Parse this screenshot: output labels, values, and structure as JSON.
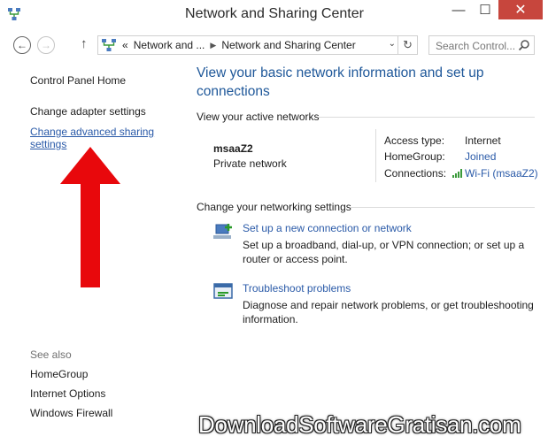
{
  "window": {
    "title": "Network and Sharing Center",
    "controls": {
      "minimize": "—",
      "maximize": "☐",
      "close": "✕"
    }
  },
  "navigation": {
    "back_icon": "←",
    "forward_icon": "→",
    "up_icon": "↑",
    "breadcrumb": [
      "«",
      "Network and ...",
      "Network and Sharing Center"
    ],
    "search_placeholder": "Search Control..."
  },
  "sidebar": {
    "home": "Control Panel Home",
    "links": [
      "Change adapter settings",
      "Change advanced sharing settings"
    ],
    "see_also_title": "See also",
    "see_also": [
      "HomeGroup",
      "Internet Options",
      "Windows Firewall"
    ]
  },
  "main": {
    "title": "View your basic network information and set up connections",
    "active_networks_heading": "View your active networks",
    "network": {
      "name": "msaaZ2",
      "type": "Private network",
      "access_type_label": "Access type:",
      "access_type_value": "Internet",
      "homegroup_label": "HomeGroup:",
      "homegroup_value": "Joined",
      "connections_label": "Connections:",
      "connections_value": "Wi-Fi (msaaZ2)"
    },
    "settings_heading": "Change your networking settings",
    "tasks": [
      {
        "title": "Set up a new connection or network",
        "description": "Set up a broadband, dial-up, or VPN connection; or set up a router or access point.",
        "icon": "new-connection-icon"
      },
      {
        "title": "Troubleshoot problems",
        "description": "Diagnose and repair network problems, or get troubleshooting information.",
        "icon": "troubleshoot-icon"
      }
    ]
  },
  "watermark": "DownloadSoftwareGratisan.com",
  "colors": {
    "link": "#2a5aa8",
    "title": "#1e5799",
    "close": "#c7463d",
    "arrow": "#e8080c"
  }
}
